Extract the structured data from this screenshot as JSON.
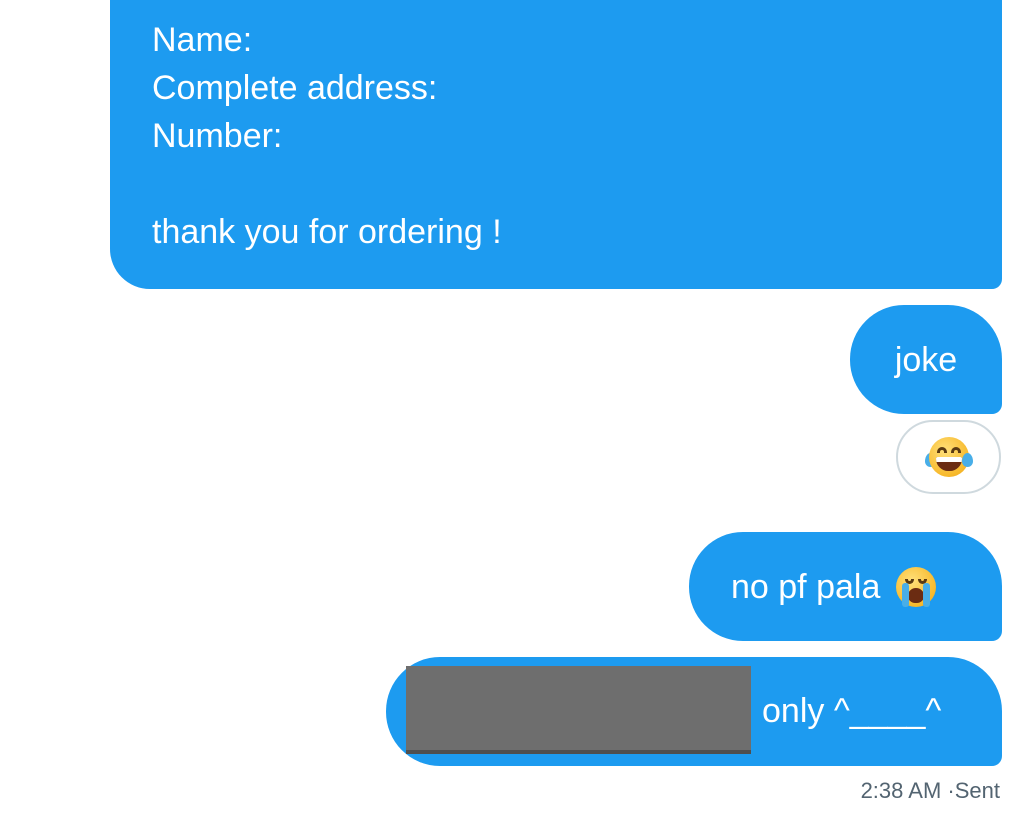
{
  "messages": [
    {
      "lines": [
        "Name:",
        "Complete address:",
        "Number:",
        "",
        "thank you for ordering !"
      ]
    },
    {
      "text": "joke"
    },
    {
      "text": "no pf pala"
    },
    {
      "text": "only ^____^"
    }
  ],
  "reaction": {
    "icon": "face-with-tears-of-joy-icon"
  },
  "pala_emoji": {
    "icon": "loudly-crying-face-icon"
  },
  "meta": {
    "time": "2:38 AM",
    "status": "·Sent"
  },
  "colors": {
    "bubble": "#1d9bf0",
    "meta_text": "#536471",
    "reaction_border": "#cfd9de"
  }
}
